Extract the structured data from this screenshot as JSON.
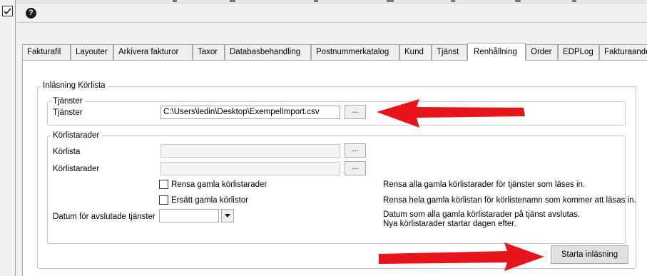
{
  "toolbar": {
    "help_icon": "?"
  },
  "tabs": [
    {
      "label": "Fakturafil"
    },
    {
      "label": "Layouter"
    },
    {
      "label": "Arkivera fakturor"
    },
    {
      "label": "Taxor"
    },
    {
      "label": "Databasbehandling"
    },
    {
      "label": "Postnummerkatalog"
    },
    {
      "label": "Kund"
    },
    {
      "label": "Tjänst"
    },
    {
      "label": "Renhållning"
    },
    {
      "label": "Order"
    },
    {
      "label": "EDPLog"
    },
    {
      "label": "Fakturaande"
    }
  ],
  "active_tab": "Renhållning",
  "main_group": {
    "legend": "Inläsning Körlista"
  },
  "services_group": {
    "legend": "Tjänster",
    "label": "Tjänster",
    "path_value": "C:\\Users\\ledin\\Desktop\\ExempelImport.csv",
    "browse_label": "..."
  },
  "route_group": {
    "legend": "Körlistarader",
    "korlista_label": "Körlista",
    "korlista_value": "",
    "korlista_browse": "...",
    "rader_label": "Körlistarader",
    "rader_value": "",
    "rader_browse": "...",
    "clear_old_label": "Rensa gamla körlistarader",
    "clear_old_checked": false,
    "clear_old_desc": "Rensa alla gamla körlistarader för tjänster som läses in.",
    "replace_old_label": "Ersätt gamla körlistor",
    "replace_old_checked": false,
    "replace_old_desc": "Rensa hela gamla körlistan för körlistenamn som kommer att läsas in.",
    "date_label": "Datum för avslutade tjänster",
    "date_value": "",
    "date_desc_1": "Datum som alla gamla körlistarader på tjänst avslutas.",
    "date_desc_2": "Nya körlistarader startar dagen efter."
  },
  "start_button_label": "Starta inläsning",
  "colors": {
    "annotation_arrow": "#e8141b",
    "window_bg": "#f0f0f0",
    "panel_bg": "#ffffff"
  },
  "icons": {
    "left_check": "checkbox-checked-icon",
    "help": "help-icon",
    "dropdown": "chevron-down-icon",
    "annotation": "arrow-annotation-icon"
  }
}
